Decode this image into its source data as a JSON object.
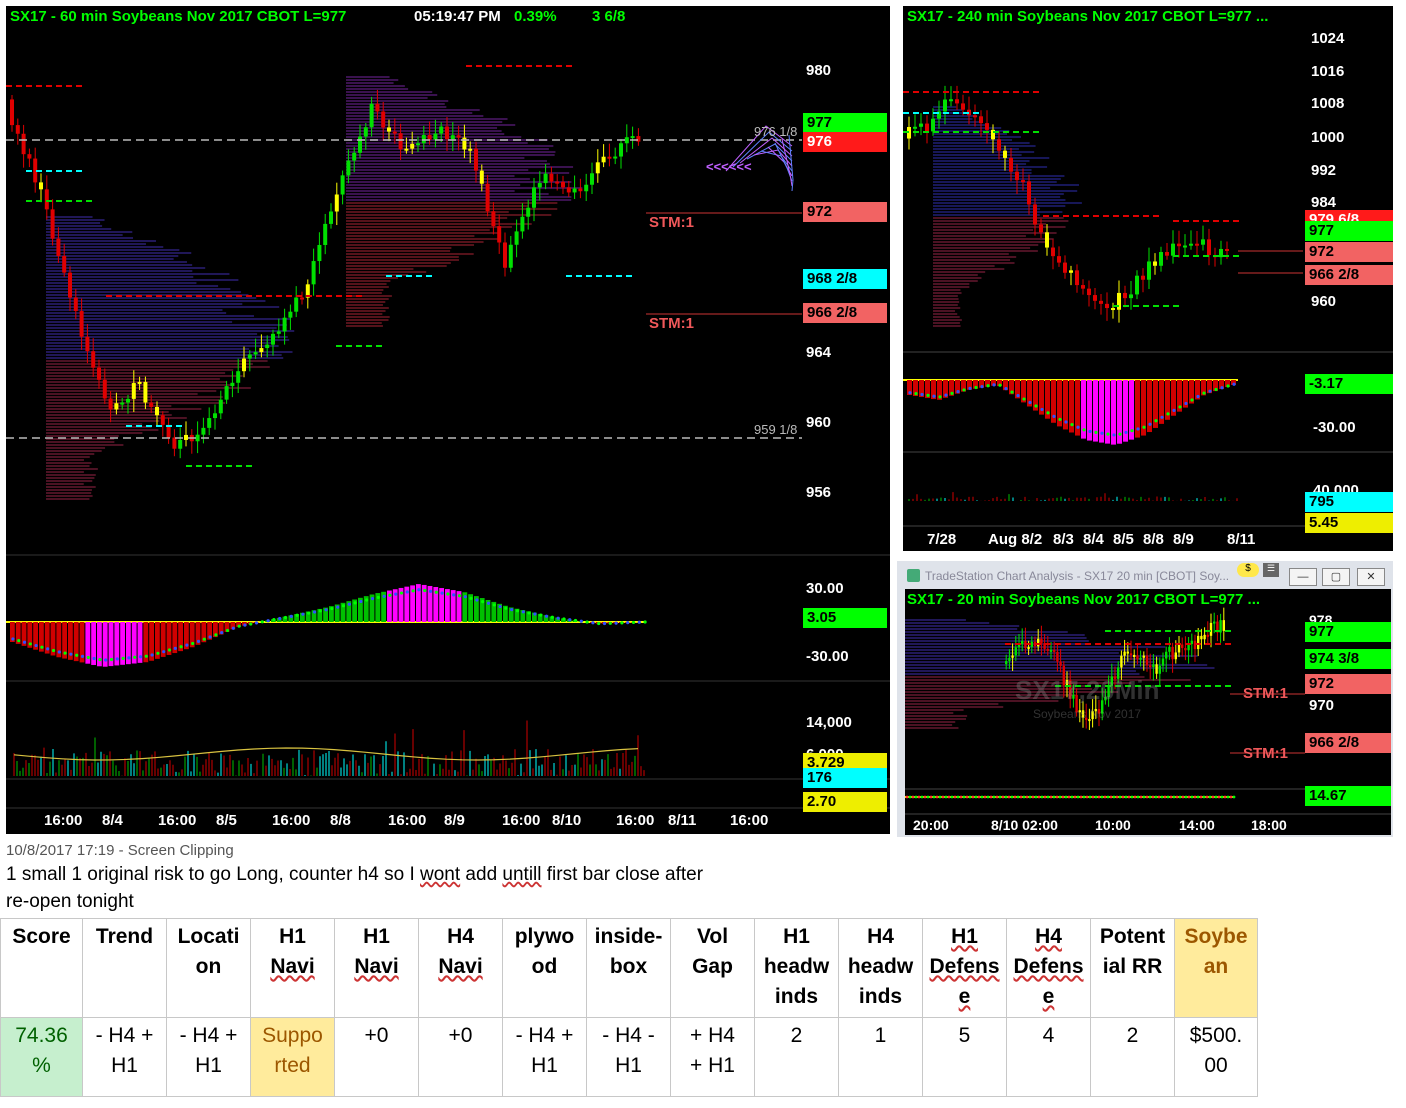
{
  "chart_main": {
    "title": "SX17 - 60 min  Soybeans Nov 2017  CBOT  L=977",
    "clock": "05:19:47 PM",
    "change_pct": "0.39%",
    "change_pts": "3 6/8",
    "price_axis": [
      "980",
      "964",
      "960",
      "956"
    ],
    "tags": [
      {
        "label": "977",
        "bg": "#00ff00",
        "fg": "#000"
      },
      {
        "label": "976",
        "bg": "#ff1a1a",
        "fg": "#fff"
      },
      {
        "label": "972",
        "bg": "#f26363",
        "fg": "#000"
      },
      {
        "label": "968 2/8",
        "bg": "#00ffff",
        "fg": "#000"
      },
      {
        "label": "966 2/8",
        "bg": "#f26363",
        "fg": "#000"
      }
    ],
    "line_labels": [
      "976 1/8",
      "959 1/8"
    ],
    "stm_labels": [
      "STM:1",
      "STM:1"
    ],
    "profile_label": "<<<<<<",
    "osc_axis": [
      "30.00",
      "-30.00"
    ],
    "osc_tag": {
      "label": "3.05",
      "bg": "#00ff00"
    },
    "vol_axis": [
      "14,000",
      "6,000"
    ],
    "vol_tags": [
      {
        "label": "3.729",
        "bg": "#eeee00"
      },
      {
        "label": "176",
        "bg": "#00ffff"
      },
      {
        "label": "2.70",
        "bg": "#eeee00"
      }
    ],
    "time_axis": [
      "16:00",
      "8/4",
      "16:00",
      "8/5",
      "16:00",
      "8/8",
      "16:00",
      "8/9",
      "16:00",
      "8/10",
      "16:00",
      "8/11",
      "16:00"
    ]
  },
  "chart_h4": {
    "title": "SX17 - 240 min  Soybeans Nov 2017  CBOT  L=977  ...",
    "price_axis": [
      "1024",
      "1016",
      "1008",
      "1000",
      "992",
      "984",
      "960"
    ],
    "tags": [
      {
        "label": "979 6/8",
        "bg": "#ff1a1a",
        "fg": "#fff"
      },
      {
        "label": "977",
        "bg": "#00ff00",
        "fg": "#000"
      },
      {
        "label": "972",
        "bg": "#f26363",
        "fg": "#000"
      },
      {
        "label": "966 2/8",
        "bg": "#f26363",
        "fg": "#000"
      }
    ],
    "osc_tag": {
      "label": "-3.17",
      "bg": "#00ff00"
    },
    "osc_axis": [
      "-30.00"
    ],
    "vol_axis": [
      "40,000"
    ],
    "vol_tags": [
      {
        "label": "795",
        "bg": "#00ffff"
      },
      {
        "label": "5.45",
        "bg": "#eeee00"
      }
    ],
    "time_axis": [
      "7/28",
      "Aug 8/2",
      "8/3",
      "8/4",
      "8/5",
      "8/8",
      "8/9",
      "8/11"
    ]
  },
  "window_20": {
    "caption": "TradeStation Chart Analysis - SX17 20 min [CBOT] Soy...",
    "title": "SX17 - 20 min  Soybeans Nov 2017  CBOT  L=977  ...",
    "watermark": "SX17,20Min",
    "watermark_sub": "Soybeans Nov 2017",
    "price_axis": [
      "978",
      "970"
    ],
    "tags": [
      {
        "label": "977",
        "bg": "#00ff00",
        "fg": "#000"
      },
      {
        "label": "974 3/8",
        "bg": "#00ff00",
        "fg": "#000"
      },
      {
        "label": "972",
        "bg": "#f26363",
        "fg": "#000"
      },
      {
        "label": "966 2/8",
        "bg": "#f26363",
        "fg": "#000"
      }
    ],
    "stm_labels": [
      "STM:1",
      "STM:1"
    ],
    "osc_tag": {
      "label": "14.67",
      "bg": "#00ff00"
    },
    "time_axis": [
      "20:00",
      "8/10  02:00",
      "10:00",
      "14:00",
      "18:00"
    ]
  },
  "clipping": {
    "stamp": "10/8/2017 17:19 - Screen Clipping",
    "note_line1_parts": [
      "1 small 1 original risk to go Long, counter h4 so I ",
      "wont",
      " add ",
      "untill",
      " first bar close after"
    ],
    "note_line2": "re-open tonight"
  },
  "journal": {
    "headers": [
      [
        "Score"
      ],
      [
        "Trend"
      ],
      [
        "Locati",
        "on"
      ],
      [
        "H1",
        "Navi"
      ],
      [
        "H1",
        "Navi"
      ],
      [
        "H4",
        "Navi"
      ],
      [
        "plywo",
        "od"
      ],
      [
        "inside-",
        "box"
      ],
      [
        "Vol",
        "Gap"
      ],
      [
        "H1",
        "headw",
        "inds"
      ],
      [
        "H4",
        "headw",
        "inds"
      ],
      [
        "H1",
        "Defens",
        "e"
      ],
      [
        "H4",
        "Defens",
        "e"
      ],
      [
        "Potent",
        "ial RR"
      ],
      [
        "Soybe",
        "an"
      ]
    ],
    "values": [
      [
        "74.36",
        "%"
      ],
      [
        "- H4 +",
        "H1"
      ],
      [
        "- H4 +",
        "H1"
      ],
      [
        "Suppo",
        "rted"
      ],
      [
        "+0"
      ],
      [
        "+0"
      ],
      [
        "- H4 +",
        "H1"
      ],
      [
        "- H4 -",
        "H1"
      ],
      [
        "+ H4",
        "+ H1"
      ],
      [
        "2"
      ],
      [
        "1"
      ],
      [
        "5"
      ],
      [
        "4"
      ],
      [
        "2"
      ],
      [
        "$500.",
        "00"
      ]
    ],
    "colors": {
      "score_bg": "#c6efce",
      "score_fg": "#006100",
      "neutral_bg": "#ffeb9c",
      "neutral_fg": "#9c5700"
    }
  }
}
